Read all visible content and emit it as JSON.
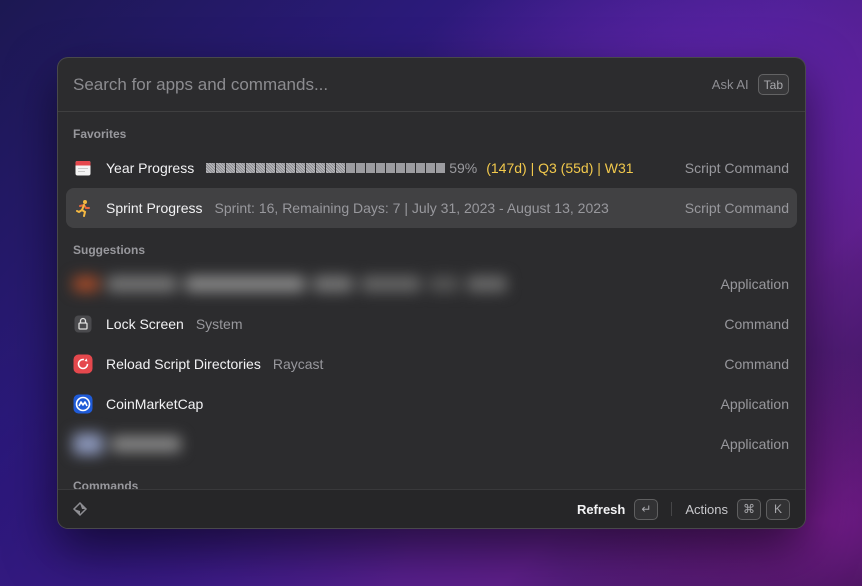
{
  "search": {
    "placeholder": "Search for apps and commands...",
    "ask_ai_label": "Ask AI",
    "ask_ai_key": "Tab"
  },
  "sections": {
    "favorites": "Favorites",
    "suggestions": "Suggestions",
    "commands": "Commands"
  },
  "favorites": [
    {
      "title": "Year Progress",
      "progress": 0.59,
      "percent_text": "59%",
      "stats_text": "(147d) | Q3 (55d) | W31",
      "type": "Script Command",
      "icon": "calendar-icon"
    },
    {
      "title": "Sprint Progress",
      "subtitle": "Sprint: 16, Remaining Days: 7 | July 31, 2023 - August 13, 2023",
      "type": "Script Command",
      "icon": "runner-icon"
    }
  ],
  "suggestions": [
    {
      "type": "Application"
    },
    {
      "title": "Lock Screen",
      "subtitle": "System",
      "type": "Command",
      "icon": "lock-icon"
    },
    {
      "title": "Reload Script Directories",
      "subtitle": "Raycast",
      "type": "Command",
      "icon": "raycast-reload-icon"
    },
    {
      "title": "CoinMarketCap",
      "type": "Application",
      "icon": "coinmarketcap-icon"
    },
    {
      "type": "Application"
    }
  ],
  "footer": {
    "primary_action": "Refresh",
    "primary_key": "↵",
    "actions_label": "Actions",
    "actions_keys": [
      "⌘",
      "K"
    ]
  },
  "colors": {
    "accent_yellow": "#f2c94c",
    "window_bg": "#2c2c2e"
  }
}
